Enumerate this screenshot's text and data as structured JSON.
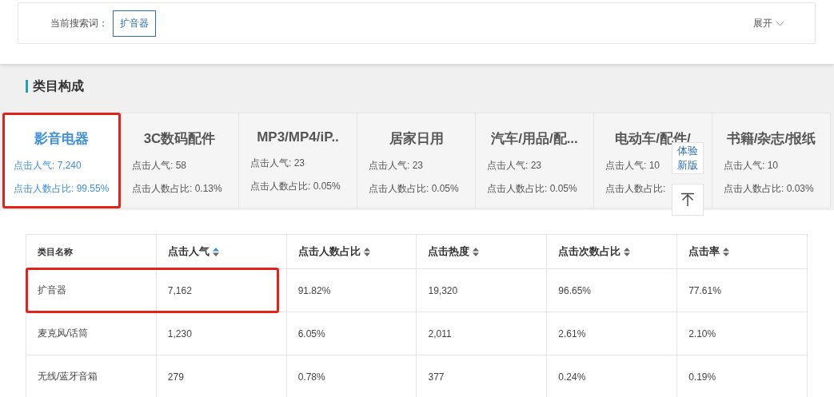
{
  "search": {
    "label": "当前搜索词：",
    "keyword": "扩音器",
    "expand": "展开"
  },
  "section": {
    "title": "类目构成"
  },
  "categories": [
    {
      "name": "影音电器",
      "lines": [
        "点击人气: 7,240",
        "点击人数占比: 99.55%"
      ],
      "selected": true,
      "highlighted": true
    },
    {
      "name": "3C数码配件",
      "lines": [
        "点击人气: 58",
        "点击人数占比: 0.13%"
      ],
      "selected": false,
      "highlighted": false
    },
    {
      "name": "MP3/MP4/iP..",
      "lines": [
        "点击人气: 23",
        "点击人数占比: 0.05%"
      ],
      "selected": false,
      "highlighted": false
    },
    {
      "name": "居家日用",
      "lines": [
        "点击人气: 23",
        "点击人数占比: 0.05%"
      ],
      "selected": false,
      "highlighted": false
    },
    {
      "name": "汽车/用品/配...",
      "lines": [
        "点击人气: 23",
        "点击人数占比: 0.05%"
      ],
      "selected": false,
      "highlighted": false
    },
    {
      "name": "电动车/配件/",
      "lines": [
        "点击人气: 10",
        "点击人数占比:"
      ],
      "selected": false,
      "highlighted": false
    },
    {
      "name": "书籍/杂志/报纸",
      "lines": [
        "点击人气: 10",
        "点击人数占比: 0.03%"
      ],
      "selected": false,
      "highlighted": false
    }
  ],
  "float_buttons": {
    "new_version": "体验新版"
  },
  "table": {
    "columns": [
      {
        "label": "类目名称",
        "sortable": false
      },
      {
        "label": "点击人气",
        "sortable": true,
        "sorted": true
      },
      {
        "label": "点击人数占比",
        "sortable": true,
        "sorted": false
      },
      {
        "label": "点击热度",
        "sortable": true,
        "sorted": false
      },
      {
        "label": "点击次数占比",
        "sortable": true,
        "sorted": false
      },
      {
        "label": "点击率",
        "sortable": true,
        "sorted": false
      }
    ],
    "rows": [
      {
        "cells": [
          "扩音器",
          "7,162",
          "91.82%",
          "19,320",
          "96.65%",
          "77.61%"
        ],
        "highlighted": true
      },
      {
        "cells": [
          "麦克风/话筒",
          "1,230",
          "6.05%",
          "2,011",
          "2.61%",
          "2.10%"
        ],
        "highlighted": false
      },
      {
        "cells": [
          "无线/蓝牙音箱",
          "279",
          "0.78%",
          "377",
          "0.24%",
          "0.19%"
        ],
        "highlighted": false
      }
    ]
  }
}
